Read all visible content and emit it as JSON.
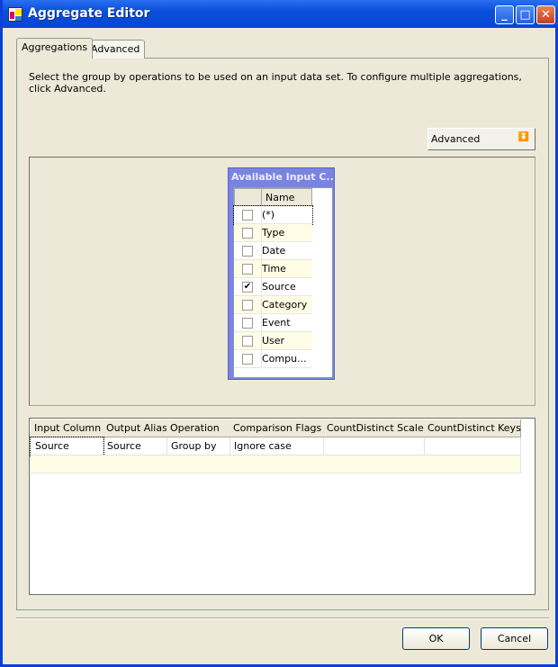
{
  "window": {
    "title": "Aggregate Editor",
    "buttons": {
      "minimize": "minimize-icon",
      "maximize": "maximize-icon",
      "close": "close-icon"
    }
  },
  "tabs": [
    {
      "label": "Aggregations",
      "active": true
    },
    {
      "label": "Advanced",
      "active": false
    }
  ],
  "description": "Select the group by operations to be used on an input data set. To configure multiple aggregations, click Advanced.",
  "advanced_button": {
    "label": "Advanced",
    "icon": "double-chevron-down-icon"
  },
  "input_columns": {
    "title": "Available Input C...",
    "header": "Name",
    "rows": [
      {
        "name": "(*)",
        "checked": false
      },
      {
        "name": "Type",
        "checked": false
      },
      {
        "name": "Date",
        "checked": false
      },
      {
        "name": "Time",
        "checked": false
      },
      {
        "name": "Source",
        "checked": true
      },
      {
        "name": "Category",
        "checked": false
      },
      {
        "name": "Event",
        "checked": false
      },
      {
        "name": "User",
        "checked": false
      },
      {
        "name": "Compu...",
        "checked": false
      }
    ]
  },
  "grid": {
    "columns": [
      "Input Column",
      "Output Alias",
      "Operation",
      "Comparison Flags",
      "CountDistinct Scale",
      "CountDistinct Keys"
    ],
    "rows": [
      [
        "Source",
        "Source",
        "Group by",
        "Ignore case",
        "",
        ""
      ]
    ]
  },
  "footer": {
    "ok": "OK",
    "cancel": "Cancel"
  },
  "colors": {
    "titlebar": "#0a4fdc",
    "alt_row": "#fffde6",
    "node_border": "#7b83e0"
  }
}
